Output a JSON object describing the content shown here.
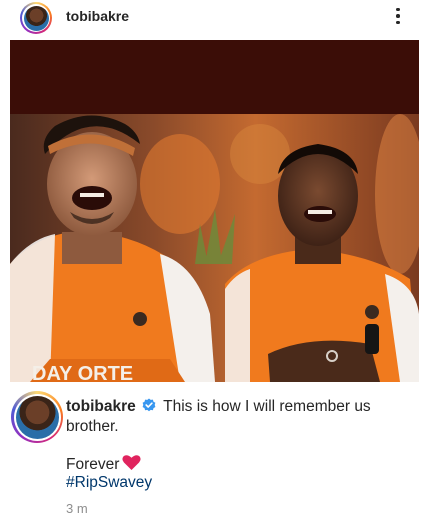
{
  "post": {
    "username": "tobibakre",
    "caption_text": "This is how I will remember us brother.",
    "forever_text": "Forever",
    "hashtag": "#RipSwavey",
    "timestamp": "3 m",
    "image_banner_text": "DAY  ORTE"
  },
  "colors": {
    "verified": "#3897f0",
    "hashtag": "#00376b",
    "heart": "#e0245e",
    "media_top_band": "#3b0d07"
  },
  "icons": {
    "more": "vertical-ellipsis",
    "verified": "verified-badge",
    "heart": "red-heart-emoji"
  }
}
